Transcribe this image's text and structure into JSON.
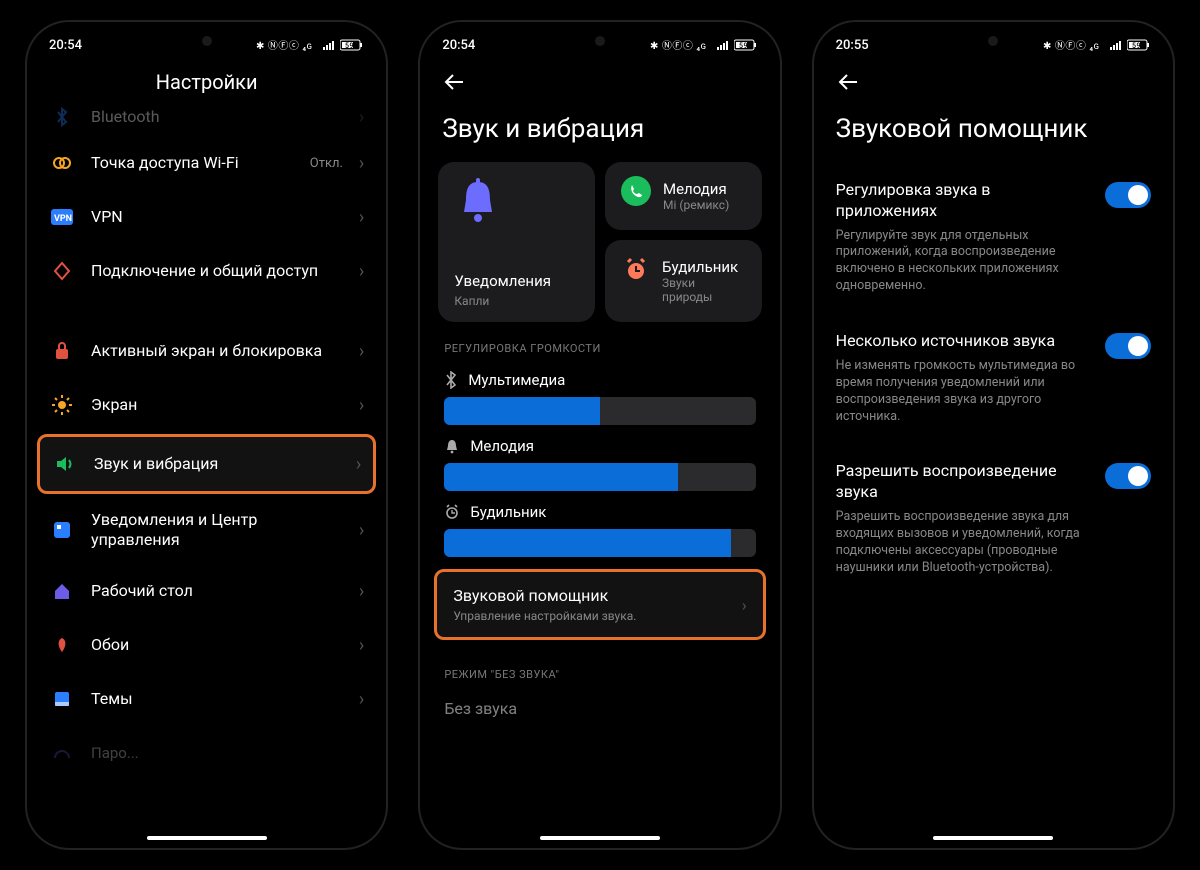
{
  "status": {
    "time1": "20:54",
    "time2": "20:54",
    "time3": "20:55",
    "icons": "✱ ⁴ᴳ ⁴ᴳ ▮▮▯ 59"
  },
  "screen1": {
    "title": "Настройки",
    "items": {
      "bluetooth": "Bluetooth",
      "hotspot": "Точка доступа Wi-Fi",
      "hotspot_state": "Откл.",
      "vpn": "VPN",
      "connection": "Подключение и общий доступ",
      "lock": "Активный экран и блокировка",
      "display": "Экран",
      "sound": "Звук и вибрация",
      "notif": "Уведомления и Центр управления",
      "home": "Рабочий стол",
      "wallpaper": "Обои",
      "themes": "Темы"
    }
  },
  "screen2": {
    "title": "Звук и вибрация",
    "tiles": {
      "notif": "Уведомления",
      "notif_sub": "Капли",
      "ringtone": "Мелодия",
      "ringtone_sub": "Mi (ремикс)",
      "alarm": "Будильник",
      "alarm_sub": "Звуки природы"
    },
    "section_volume": "РЕГУЛИРОВКА ГРОМКОСТИ",
    "sliders": {
      "media": "Мультимедиа",
      "media_pct": 50,
      "ringtone": "Мелодия",
      "ringtone_pct": 75,
      "alarm": "Будильник",
      "alarm_pct": 92
    },
    "assistant_title": "Звуковой помощник",
    "assistant_sub": "Управление настройками звука.",
    "section_silent": "РЕЖИМ \"БЕЗ ЗВУКА\"",
    "silent": "Без звука"
  },
  "screen3": {
    "title": "Звуковой помощник",
    "opts": {
      "t1": "Регулировка звука в приложениях",
      "d1": "Регулируйте звук для отдельных приложений, когда воспроизведение включено в нескольких приложениях одновременно.",
      "t2": "Несколько источников звука",
      "d2": "Не изменять громкость мультимедиа во время получения уведомлений или воспроизведения звука из другого источника.",
      "t3": "Разрешить воспроизведение звука",
      "d3": "Разрешить воспроизведение звука для входящих вызовов и уведомлений, когда подключены аксессуары (проводные наушники или Bluetooth-устройства)."
    }
  }
}
